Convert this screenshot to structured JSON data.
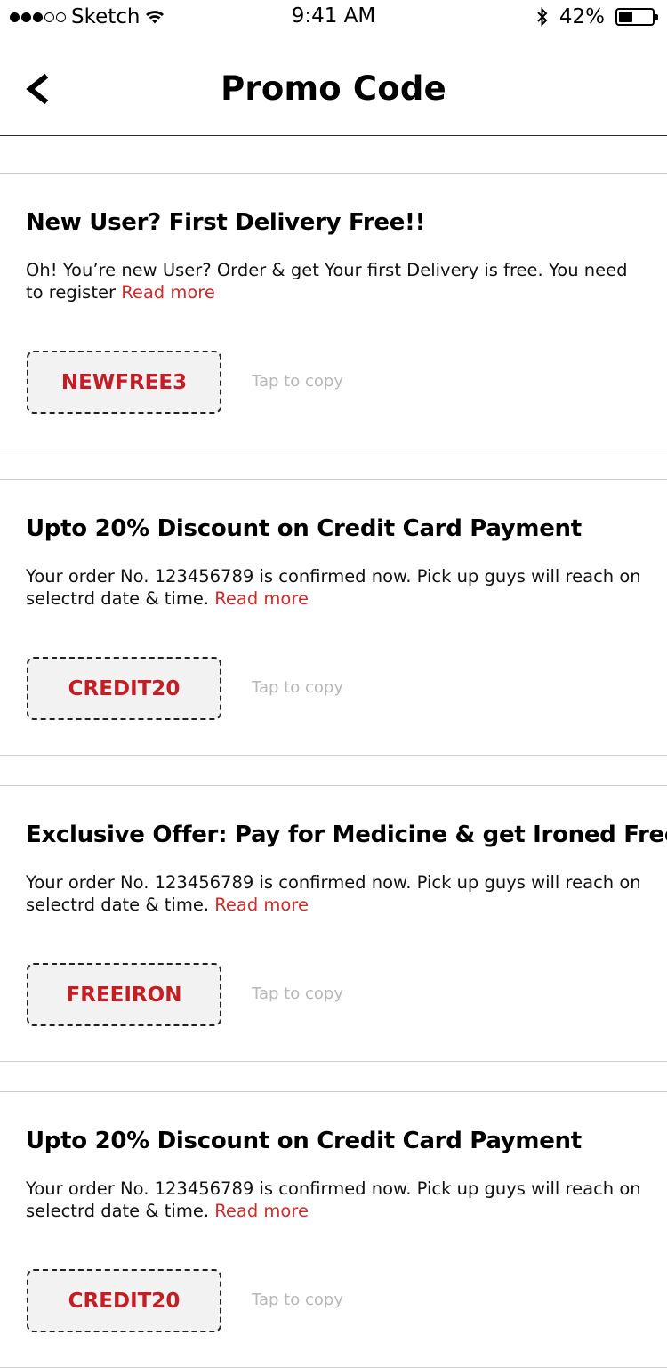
{
  "status_bar": {
    "carrier": "Sketch",
    "time": "9:41 AM",
    "battery": "42%",
    "battery_level": 0.42
  },
  "header": {
    "title": "Promo Code"
  },
  "promos": [
    {
      "title": "New User? First Delivery Free!!",
      "description": "Oh! You’re new User? Order & get Your first Delivery is free. You need to register",
      "read_more": "Read more",
      "code": "NEWFREE3",
      "copy_hint": "Tap to copy"
    },
    {
      "title": "Upto 20% Discount on Credit Card Payment",
      "description": "Your order No. 123456789 is confirmed now. Pick up guys will reach on selectrd date & time.",
      "read_more": "Read more",
      "code": "CREDIT20",
      "copy_hint": "Tap to copy"
    },
    {
      "title": "Exclusive Offer: Pay for Medicine & get Ironed Free",
      "description": "Your order No. 123456789 is confirmed now. Pick up guys will reach on selectrd date & time.",
      "read_more": "Read more",
      "code": "FREEIRON",
      "copy_hint": "Tap to copy"
    },
    {
      "title": "Upto 20% Discount on Credit Card Payment",
      "description": "Your order No. 123456789 is confirmed now. Pick up guys will reach on selectrd date & time.",
      "read_more": "Read more",
      "code": "CREDIT20",
      "copy_hint": "Tap to copy"
    }
  ],
  "colors": {
    "accent": "#c41e25",
    "link": "#d12b2b",
    "hint": "#b8b8b8"
  }
}
